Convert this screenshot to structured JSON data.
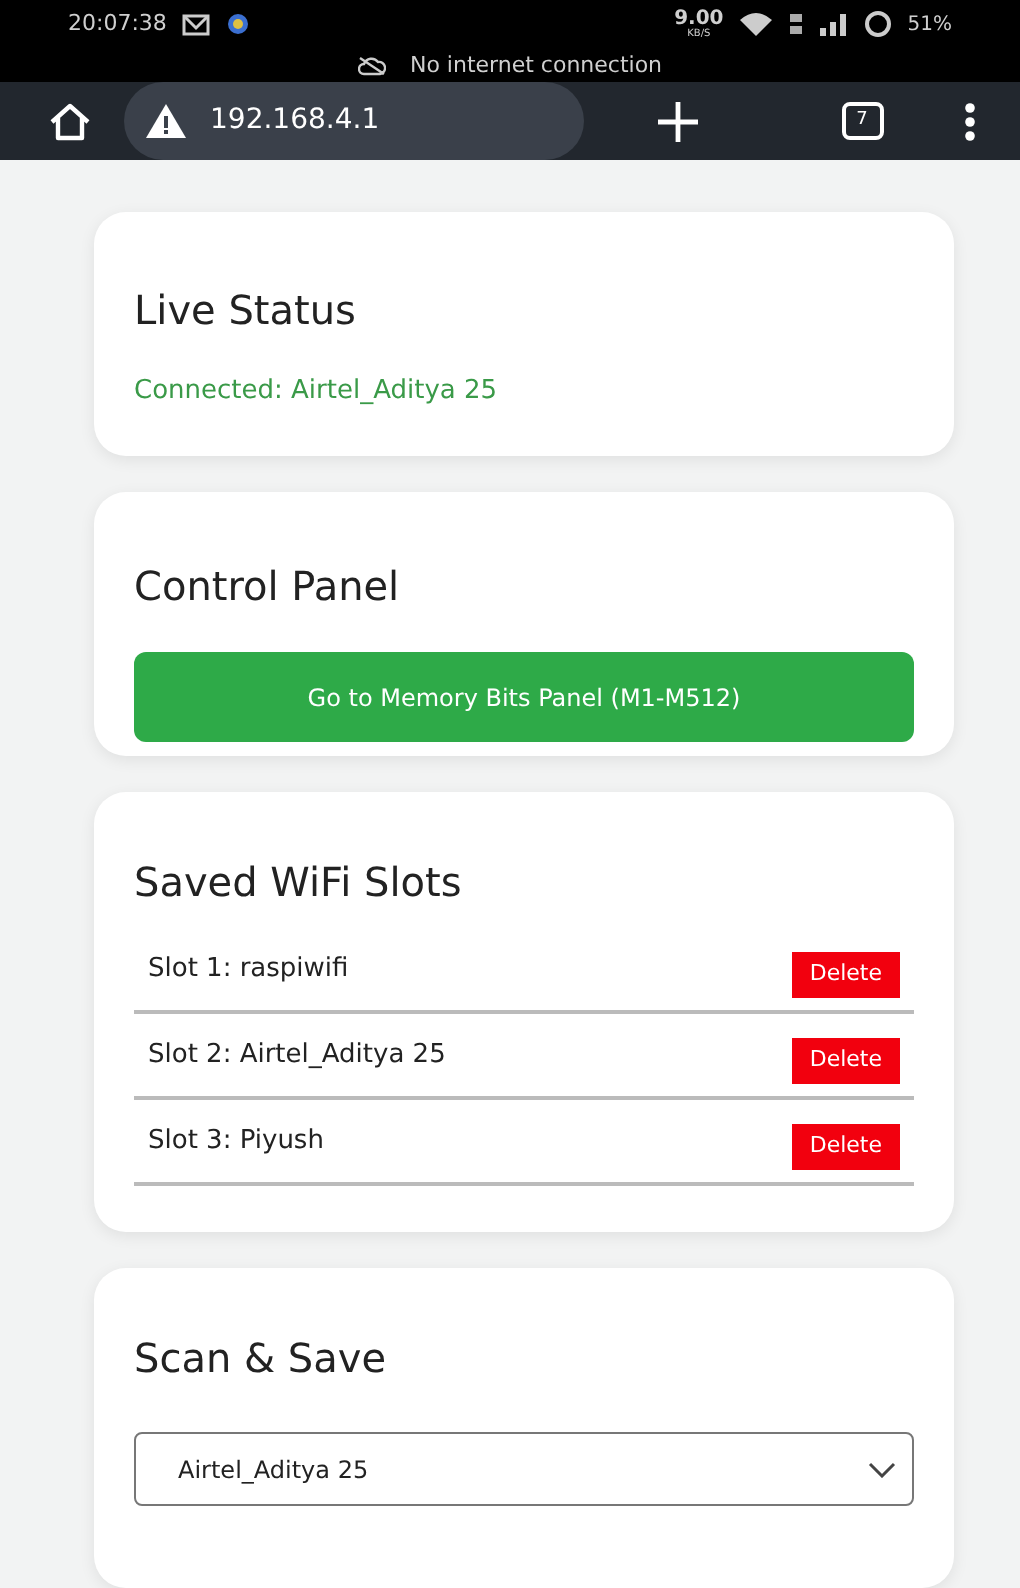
{
  "status_bar": {
    "time": "20:07:38",
    "speed_value": "9.00",
    "speed_unit": "KB/S",
    "battery": "51%"
  },
  "offline_banner": {
    "text": "No internet connection"
  },
  "browser": {
    "url": "192.168.4.1",
    "tab_count": "7"
  },
  "live_status": {
    "title": "Live Status",
    "status": "Connected: Airtel_Aditya 25",
    "connected": true
  },
  "control_panel": {
    "title": "Control Panel",
    "button": "Go to Memory Bits Panel (M1-M512)"
  },
  "saved_wifi": {
    "title": "Saved WiFi Slots",
    "slots": [
      {
        "label": "Slot 1: raspiwifi",
        "action": "Delete"
      },
      {
        "label": "Slot 2: Airtel_Aditya 25",
        "action": "Delete"
      },
      {
        "label": "Slot 3: Piyush",
        "action": "Delete"
      }
    ]
  },
  "scan_save": {
    "title": "Scan & Save",
    "network_select": "Airtel_Aditya 25"
  }
}
